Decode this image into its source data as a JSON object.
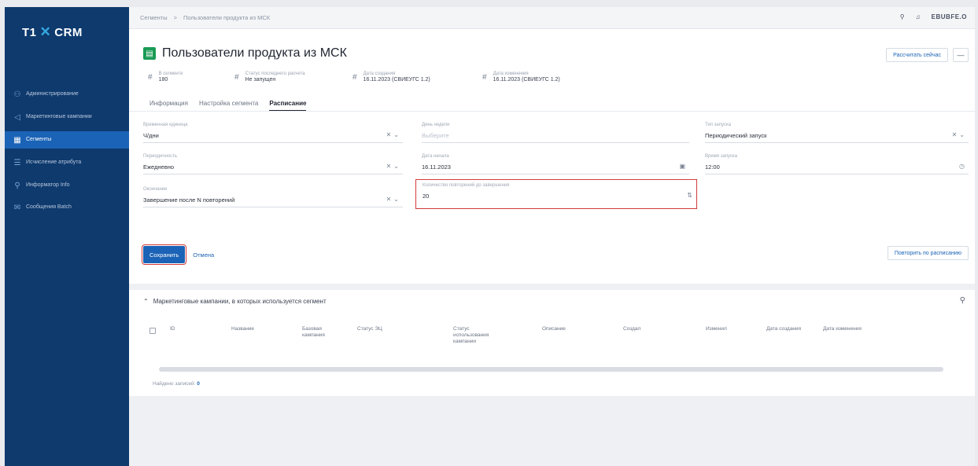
{
  "app": {
    "logo_text": "T1",
    "logo_suffix": "CRM"
  },
  "sidebar": {
    "items": [
      {
        "label": "Администрирование",
        "icon": "people-icon"
      },
      {
        "label": "Маркетинговые кампании",
        "icon": "megaphone-icon"
      },
      {
        "label": "Сегменты",
        "icon": "grid-icon",
        "active": true
      },
      {
        "label": "Исчисление атрибута",
        "icon": "list-icon"
      },
      {
        "label": "Информатор Info",
        "icon": "search-person-icon"
      },
      {
        "label": "Сообщения Batch",
        "icon": "message-icon"
      }
    ]
  },
  "topbar": {
    "breadcrumb": [
      "Сегменты",
      ">",
      "Пользователи продукта из МСК"
    ],
    "user": "EBUBFE.O"
  },
  "header": {
    "title": "Пользователи продукта из МСК",
    "actions": {
      "primary": "Рассчитать сейчас",
      "more": "—"
    },
    "meta": [
      {
        "label": "В сегменте",
        "value": "180"
      },
      {
        "label": "Статус последнего расчета",
        "value": "Не запущен"
      },
      {
        "label": "Дата создания",
        "value": "16.11.2023 (СВИЕУГС 1.2)"
      },
      {
        "label": "Дата изменения",
        "value": "16.11.2023 (СВИЕУГС 1.2)"
      }
    ],
    "tabs": [
      {
        "label": "Информация"
      },
      {
        "label": "Настройка сегмента"
      },
      {
        "label": "Расписание",
        "active": true
      }
    ]
  },
  "form": {
    "period": {
      "label": "Временная единица",
      "value": "Ч/дни"
    },
    "day_of_week": {
      "label": "День недели",
      "value": "Выберите"
    },
    "start_type": {
      "label": "Тип запуска",
      "value": "Периодический запуск"
    },
    "periodicity": {
      "label": "Периодичность",
      "value": "Ежедневно"
    },
    "start_date": {
      "label": "Дата начала",
      "value": "16.11.2023"
    },
    "start_time": {
      "label": "Время запуска",
      "value": "12:00"
    },
    "end_condition": {
      "label": "Окончание",
      "value": "Завершение после N повторений"
    },
    "repetitions": {
      "label": "Количество повторений до завершения",
      "value": "20"
    },
    "save_label": "Сохранить",
    "cancel_label": "Отмена",
    "schedule_label": "Повторить по расписанию"
  },
  "campaigns": {
    "title": "Маркетинговые кампании, в которых используется сегмент",
    "columns": [
      "ID",
      "Название",
      "Базовая кампания",
      "Статус ЭЦ",
      "Статус использования кампании",
      "Описание",
      "Создал",
      "Изменил",
      "Дата создания",
      "Дата изменения"
    ],
    "found_label": "Найдено записей:",
    "found_count": "0"
  }
}
